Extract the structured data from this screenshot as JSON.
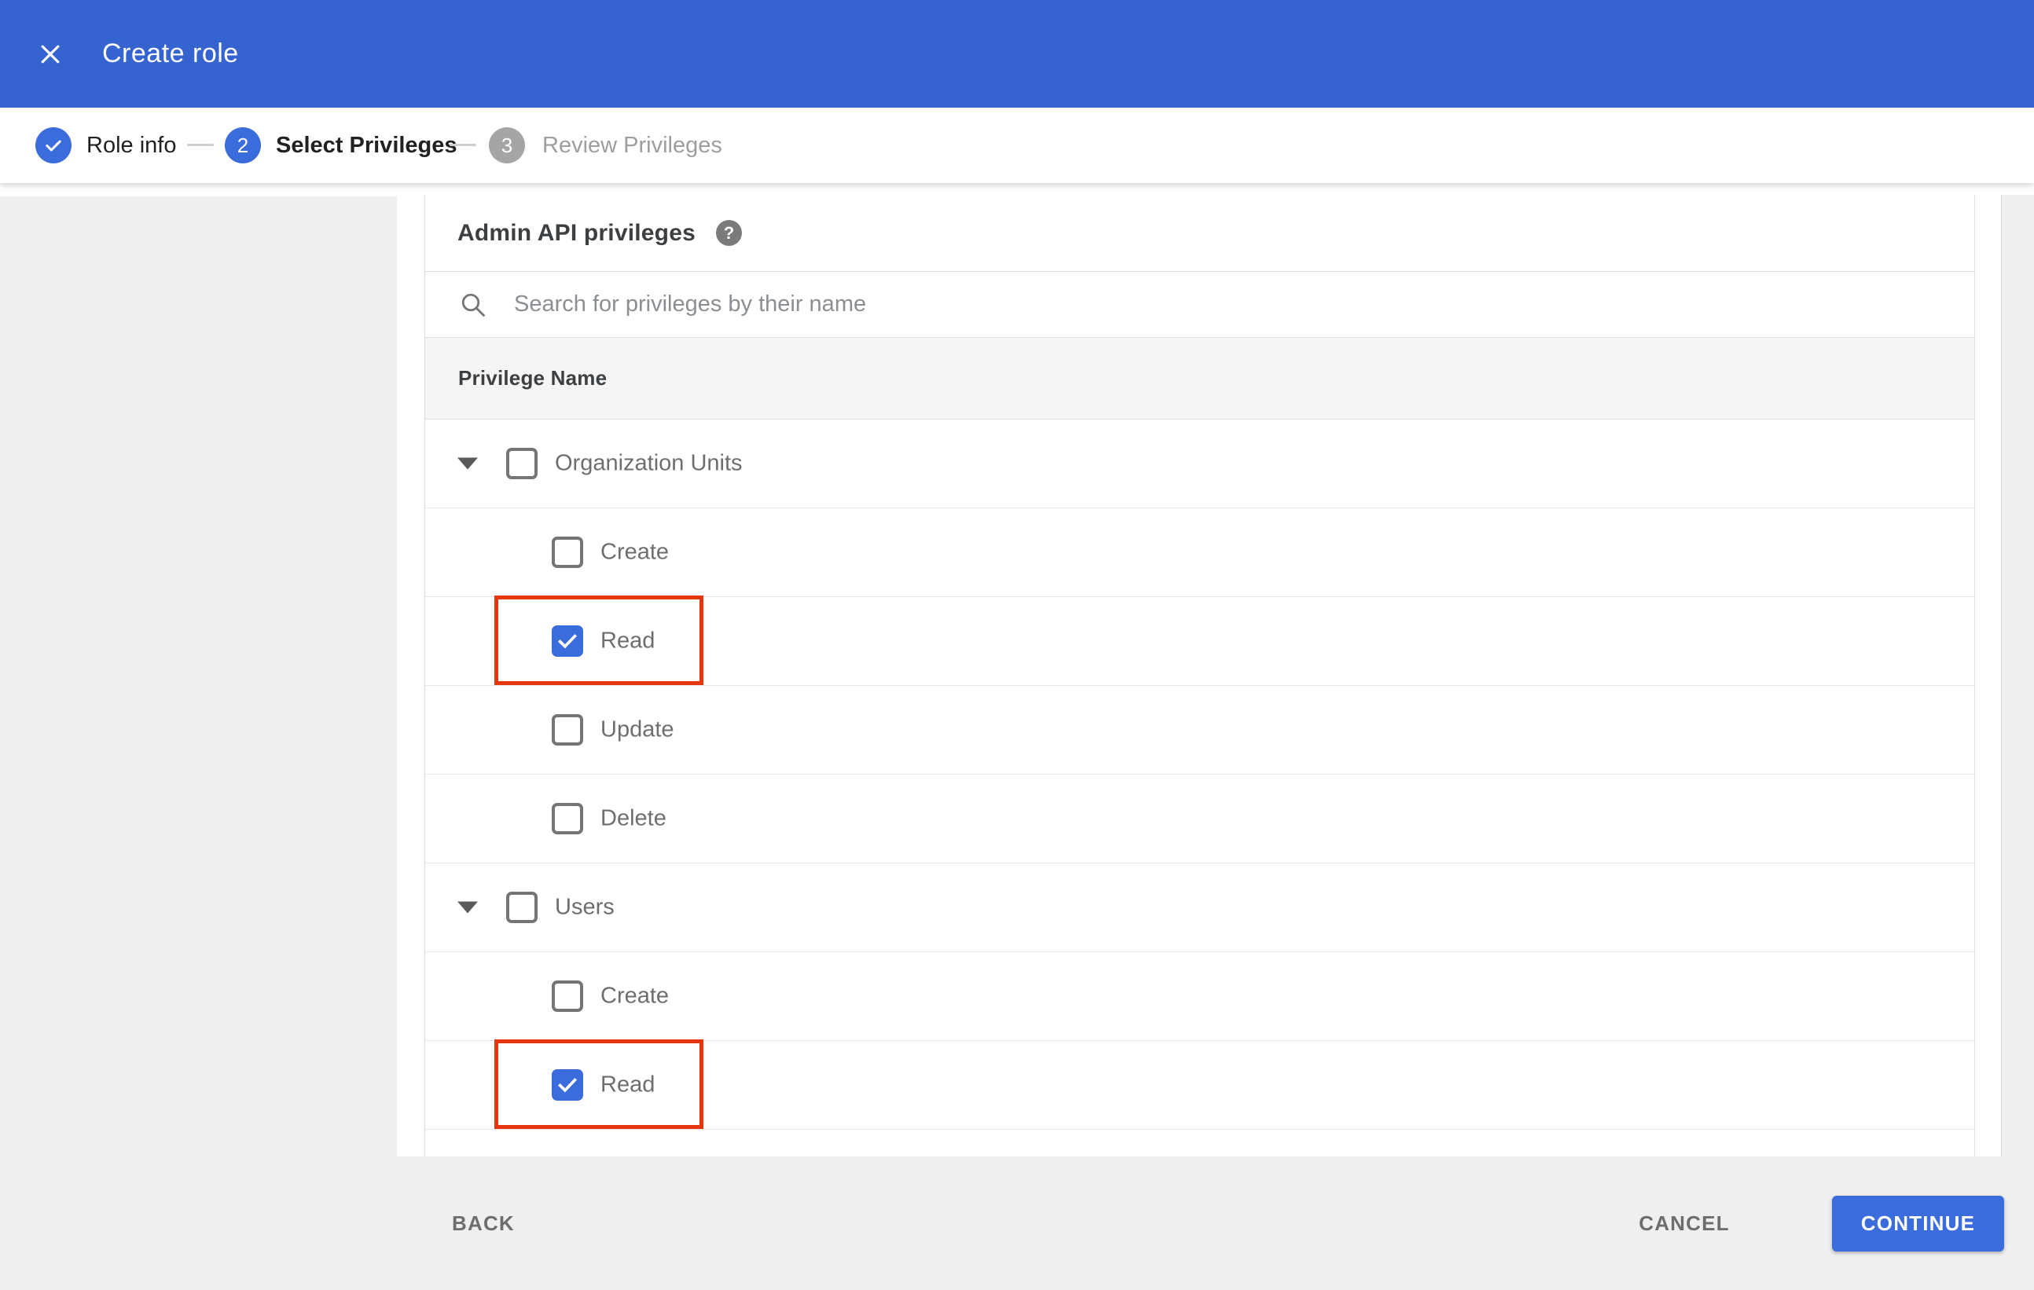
{
  "window": {
    "title": "Create role"
  },
  "stepper": [
    {
      "number": "",
      "label": "Role info",
      "state": "done"
    },
    {
      "number": "2",
      "label": "Select Privileges",
      "state": "current"
    },
    {
      "number": "3",
      "label": "Review Privileges",
      "state": "upcoming"
    }
  ],
  "content": {
    "section_title": "Admin API privileges",
    "help_icon_glyph": "?",
    "search_placeholder": "Search for privileges by their name",
    "table_header": "Privilege Name",
    "rows": [
      {
        "label": "Organization Units",
        "type": "parent",
        "expanded": true,
        "checked": false,
        "highlighted": false
      },
      {
        "label": "Create",
        "type": "child",
        "checked": false,
        "highlighted": false
      },
      {
        "label": "Read",
        "type": "child",
        "checked": true,
        "highlighted": true
      },
      {
        "label": "Update",
        "type": "child",
        "checked": false,
        "highlighted": false
      },
      {
        "label": "Delete",
        "type": "child",
        "checked": false,
        "highlighted": false
      },
      {
        "label": "Users",
        "type": "parent",
        "expanded": true,
        "checked": false,
        "highlighted": false
      },
      {
        "label": "Create",
        "type": "child",
        "checked": false,
        "highlighted": false
      },
      {
        "label": "Read",
        "type": "child",
        "checked": true,
        "highlighted": true
      }
    ]
  },
  "footer": {
    "back_label": "BACK",
    "cancel_label": "CANCEL",
    "continue_label": "CONTINUE"
  },
  "colors": {
    "header_blue": "#3563cf",
    "accent_blue": "#3a6cdb",
    "highlight_red": "#e8360c",
    "panel_gray": "#efefef",
    "table_header_bg": "#f5f5f5",
    "divider": "#e0e0e0",
    "text_dark": "#3c4043",
    "text_gray": "#6e6e6e",
    "text_light_gray": "#9e9e9e",
    "step_gray": "#a5a5a5",
    "checkbox_border": "#757575"
  }
}
